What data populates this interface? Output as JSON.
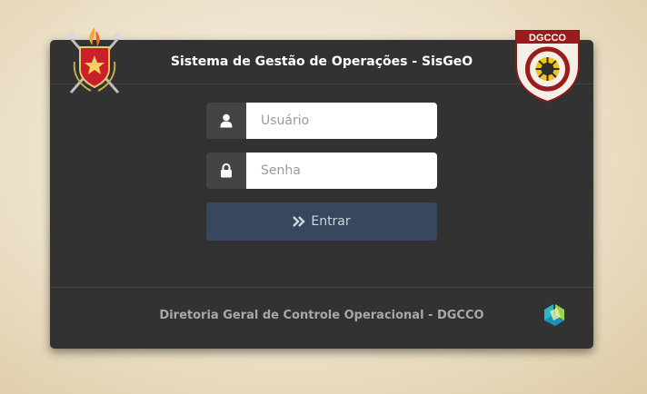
{
  "header": {
    "title": "Sistema de Gestão de Operações - SisGeO",
    "left_emblem_icon": "fire-department-crest-icon",
    "right_emblem_icon": "dgcco-shield-icon",
    "right_emblem_text": "DGCCO"
  },
  "login": {
    "username_placeholder": "Usuário",
    "username_value": "",
    "username_icon": "user-icon",
    "password_placeholder": "Senha",
    "password_value": "",
    "password_icon": "lock-icon",
    "submit_label": "Entrar",
    "submit_icon": "double-chevron-right-icon"
  },
  "footer": {
    "text": "Diretoria Geral de Controle Operacional - DGCCO",
    "logo_icon": "company-logo-icon"
  },
  "colors": {
    "panel": "#323232",
    "addon": "#444444",
    "button": "#37475e",
    "dgcco_red": "#9b1c1c",
    "logo_cyan": "#29b6c8",
    "logo_green": "#9bd14b"
  }
}
